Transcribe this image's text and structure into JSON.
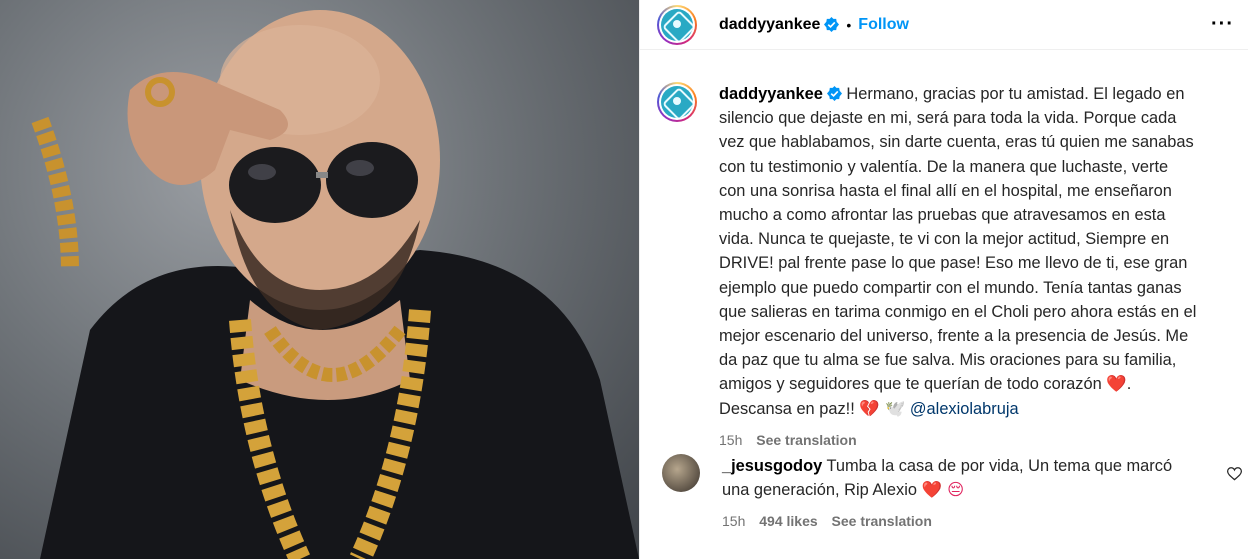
{
  "post": {
    "username": "daddyyankee",
    "follow_label": "Follow",
    "more_label": "···",
    "caption_text": "Hermano, gracias por tu amistad. El legado en silencio que dejaste en mi, será para toda la vida. Porque cada vez que hablabamos, sin darte cuenta, eras tú quien me sanabas con tu testimonio y valentía. De la manera que luchaste, verte con una sonrisa hasta el final allí en el hospital, me enseñaron mucho a como afrontar las pruebas que atravesamos en esta vida. Nunca te quejaste, te vi con la mejor actitud, Siempre en DRIVE! pal frente pase lo que pase! Eso me llevo de ti, ese gran ejemplo que puedo compartir con el mundo. Tenía tantas ganas que salieras en tarima conmigo en el Choli pero ahora estás en el mejor escenario del universo, frente a la presencia de Jesús. Me da paz que tu alma se fue salva. Mis oraciones para su familia, amigos y seguidores que te querían de todo corazón",
    "caption_heart": "❤️",
    "caption_end": ". Descansa en paz!!",
    "caption_emojis": "💔 🕊️",
    "mention": "@alexiolabruja",
    "time": "15h",
    "see_translation": "See translation"
  },
  "comment": {
    "username": "_jesusgodoy",
    "text": "Tumba la casa de por vida, Un tema que marcó una generación, Rip Alexio",
    "emojis": "❤️ 😔",
    "time": "15h",
    "likes": "494 likes",
    "see_translation": "See translation"
  },
  "colors": {
    "accent": "#0095f6",
    "mention": "#00376b",
    "secondary_text": "#737373"
  },
  "icons": [
    "verified-badge-icon",
    "more-options-icon",
    "heart-icon"
  ]
}
